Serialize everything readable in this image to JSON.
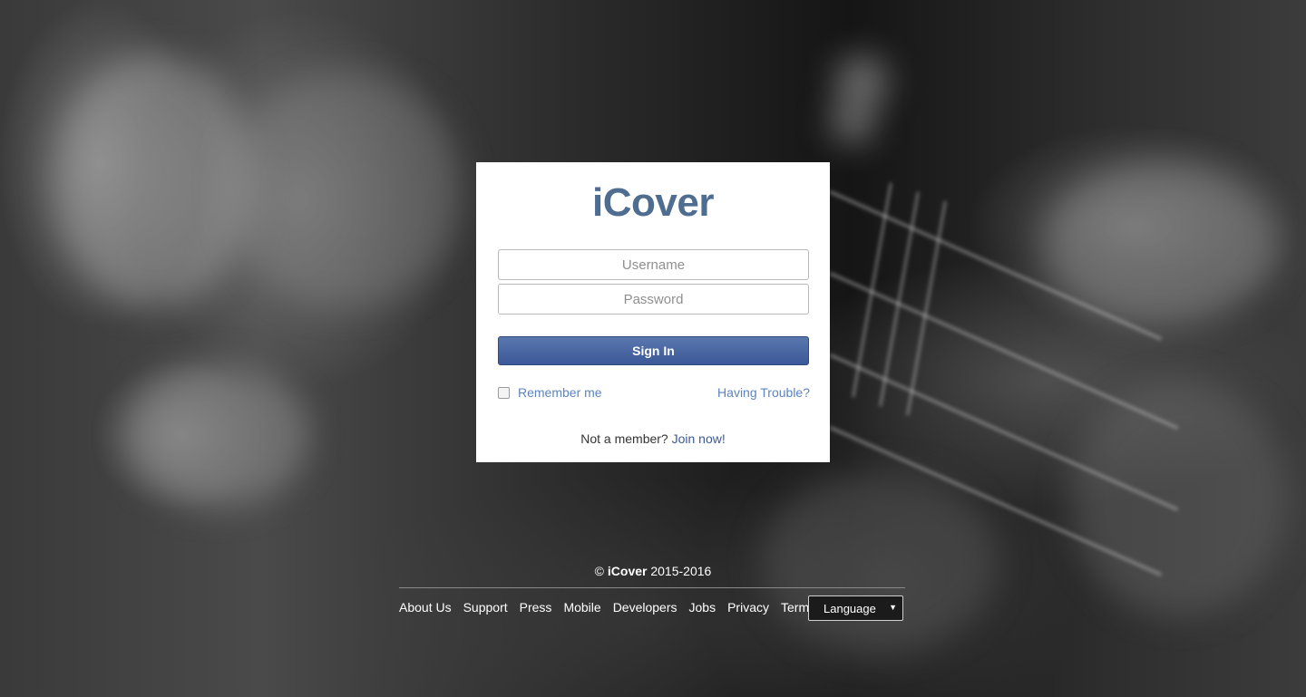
{
  "brand": {
    "name": "iCover",
    "color": "#4e6d91"
  },
  "login": {
    "username_placeholder": "Username",
    "password_placeholder": "Password",
    "signin_label": "Sign In",
    "remember_label": "Remember me",
    "remember_checked": false,
    "trouble_label": "Having Trouble?",
    "member_prompt": "Not a member?",
    "join_label": "Join now!"
  },
  "footer": {
    "copyright_symbol": "©",
    "copyright_brand": "iCover",
    "copyright_years": "2015-2016",
    "links": [
      {
        "label": "About Us"
      },
      {
        "label": "Support"
      },
      {
        "label": "Press"
      },
      {
        "label": "Mobile"
      },
      {
        "label": "Developers"
      },
      {
        "label": "Jobs"
      },
      {
        "label": "Privacy"
      },
      {
        "label": "Terms"
      }
    ],
    "language_label": "Language",
    "language_caret": "▼"
  },
  "colors": {
    "accent": "#3b5998",
    "link": "#5b84c0"
  }
}
